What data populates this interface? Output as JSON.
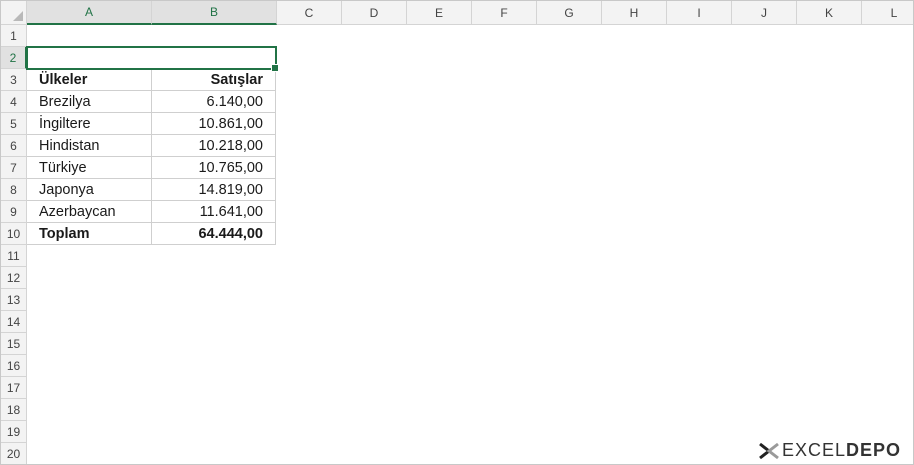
{
  "columns": [
    "A",
    "B",
    "C",
    "D",
    "E",
    "F",
    "G",
    "H",
    "I",
    "J",
    "K",
    "L"
  ],
  "rows": [
    "1",
    "2",
    "3",
    "4",
    "5",
    "6",
    "7",
    "8",
    "9",
    "10",
    "11",
    "12",
    "13",
    "14",
    "15",
    "16",
    "17",
    "18",
    "19",
    "20"
  ],
  "table": {
    "header": {
      "country": "Ülkeler",
      "sales": "Satışlar"
    },
    "rows": [
      {
        "country": "Brezilya",
        "sales": "6.140,00"
      },
      {
        "country": "İngiltere",
        "sales": "10.861,00"
      },
      {
        "country": "Hindistan",
        "sales": "10.218,00"
      },
      {
        "country": "Türkiye",
        "sales": "10.765,00"
      },
      {
        "country": "Japonya",
        "sales": "14.819,00"
      },
      {
        "country": "Azerbaycan",
        "sales": "11.641,00"
      }
    ],
    "total": {
      "label": "Toplam",
      "value": "64.444,00"
    }
  },
  "selection": {
    "range": "A2:B2",
    "accent": "#217346"
  },
  "logo": {
    "part1": "EXCEL",
    "part2": "DEPO",
    "icon": "excel-depo-x-icon"
  }
}
